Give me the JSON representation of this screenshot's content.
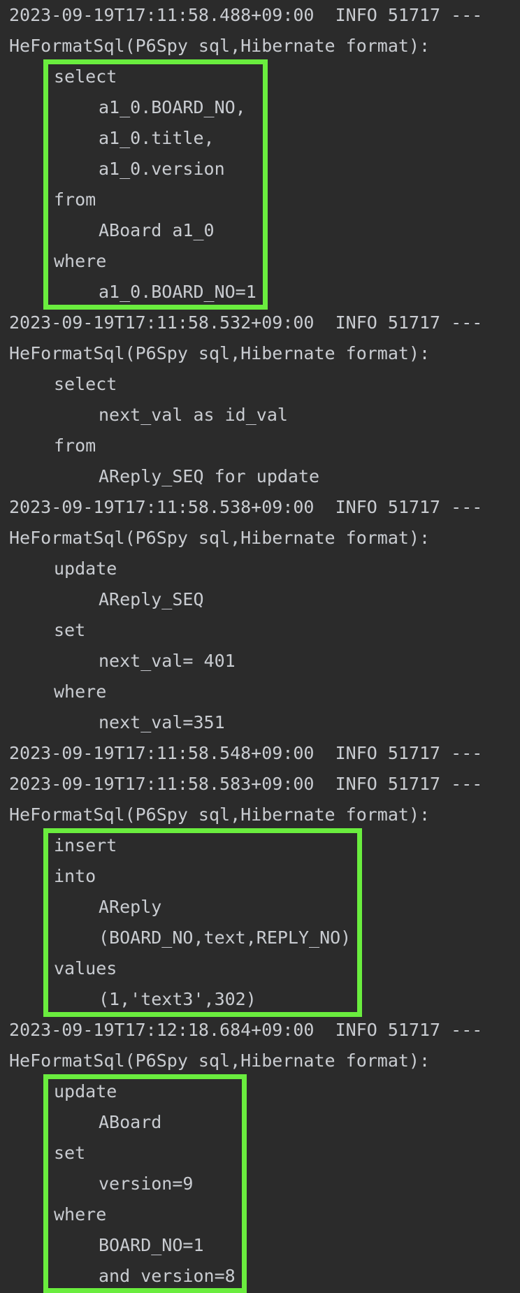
{
  "console": {
    "lines": [
      {
        "text": "2023-09-19T17:11:58.488+09:00  INFO 51717 ---",
        "indent": 0
      },
      {
        "text": "HeFormatSql(P6Spy sql,Hibernate format):",
        "indent": 0
      },
      {
        "text": "select",
        "indent": 1
      },
      {
        "text": "a1_0.BOARD_NO,",
        "indent": 2
      },
      {
        "text": "a1_0.title,",
        "indent": 2
      },
      {
        "text": "a1_0.version",
        "indent": 2
      },
      {
        "text": "from",
        "indent": 1
      },
      {
        "text": "ABoard a1_0",
        "indent": 2
      },
      {
        "text": "where",
        "indent": 1
      },
      {
        "text": "a1_0.BOARD_NO=1",
        "indent": 2
      },
      {
        "text": "2023-09-19T17:11:58.532+09:00  INFO 51717 ---",
        "indent": 0
      },
      {
        "text": "HeFormatSql(P6Spy sql,Hibernate format):",
        "indent": 0
      },
      {
        "text": "select",
        "indent": 1
      },
      {
        "text": "next_val as id_val",
        "indent": 2
      },
      {
        "text": "from",
        "indent": 1
      },
      {
        "text": "AReply_SEQ for update",
        "indent": 2
      },
      {
        "text": "2023-09-19T17:11:58.538+09:00  INFO 51717 ---",
        "indent": 0
      },
      {
        "text": "HeFormatSql(P6Spy sql,Hibernate format):",
        "indent": 0
      },
      {
        "text": "update",
        "indent": 1
      },
      {
        "text": "AReply_SEQ",
        "indent": 2
      },
      {
        "text": "set",
        "indent": 1
      },
      {
        "text": "next_val= 401",
        "indent": 2
      },
      {
        "text": "where",
        "indent": 1
      },
      {
        "text": "next_val=351",
        "indent": 2
      },
      {
        "text": "2023-09-19T17:11:58.548+09:00  INFO 51717 ---",
        "indent": 0
      },
      {
        "text": "2023-09-19T17:11:58.583+09:00  INFO 51717 ---",
        "indent": 0
      },
      {
        "text": "HeFormatSql(P6Spy sql,Hibernate format):",
        "indent": 0
      },
      {
        "text": "insert",
        "indent": 1
      },
      {
        "text": "into",
        "indent": 1
      },
      {
        "text": "AReply",
        "indent": 2
      },
      {
        "text": "(BOARD_NO,text,REPLY_NO)",
        "indent": 2
      },
      {
        "text": "values",
        "indent": 1
      },
      {
        "text": "(1,'text3',302)",
        "indent": 2
      },
      {
        "text": "2023-09-19T17:12:18.684+09:00  INFO 51717 ---",
        "indent": 0
      },
      {
        "text": "HeFormatSql(P6Spy sql,Hibernate format):",
        "indent": 0
      },
      {
        "text": "update",
        "indent": 1
      },
      {
        "text": "ABoard",
        "indent": 2
      },
      {
        "text": "set",
        "indent": 1
      },
      {
        "text": "version=9",
        "indent": 2
      },
      {
        "text": "where",
        "indent": 1
      },
      {
        "text": "BOARD_NO=1",
        "indent": 2
      },
      {
        "text": "and version=8",
        "indent": 2
      }
    ]
  },
  "highlights": [
    {
      "name": "highlight-select-aboard",
      "first_line": 2,
      "last_line": 9
    },
    {
      "name": "highlight-insert-areply",
      "first_line": 27,
      "last_line": 32
    },
    {
      "name": "highlight-update-aboard",
      "first_line": 35,
      "last_line": 41
    }
  ],
  "colors": {
    "background": "#2b2b2b",
    "text": "#c9ccd1",
    "highlight_border": "#6aed3e"
  }
}
